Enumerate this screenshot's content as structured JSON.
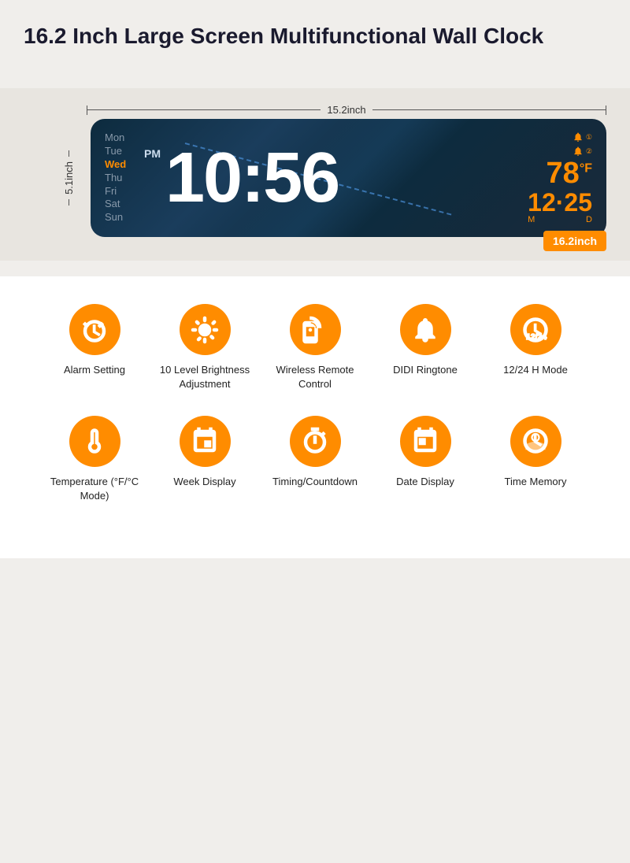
{
  "page": {
    "title": "16.2 Inch Large Screen Multifunctional Wall Clock",
    "background_color": "#f0eeeb"
  },
  "clock": {
    "width_label": "15.2inch",
    "height_label": "5.1inch",
    "size_badge": "16.2inch",
    "days": [
      "Mon",
      "Tue",
      "Wed",
      "Thu",
      "Fri",
      "Sat",
      "Sun"
    ],
    "active_day": "Wed",
    "am_pm": "PM",
    "time": "10:56",
    "temperature": "78",
    "temp_unit": "°F",
    "date": "12·25",
    "month_label": "M",
    "day_label": "D"
  },
  "features": {
    "row1": [
      {
        "id": "alarm-setting",
        "label": "Alarm Setting",
        "icon": "alarm"
      },
      {
        "id": "brightness",
        "label": "10 Level Brightness Adjustment",
        "icon": "brightness"
      },
      {
        "id": "remote",
        "label": "Wireless Remote Control",
        "icon": "remote"
      },
      {
        "id": "ringtone",
        "label": "DIDI Ringtone",
        "icon": "bell"
      },
      {
        "id": "hour-mode",
        "label": "12/24 H Mode",
        "icon": "clock-12-24"
      }
    ],
    "row2": [
      {
        "id": "temperature",
        "label": "Temperature (°F/°C Mode)",
        "icon": "thermometer"
      },
      {
        "id": "week-display",
        "label": "Week Display",
        "icon": "calendar-week"
      },
      {
        "id": "timing",
        "label": "Timing/Countdown",
        "icon": "stopwatch"
      },
      {
        "id": "date-display",
        "label": "Date Display",
        "icon": "calendar-date"
      },
      {
        "id": "time-memory",
        "label": "Time Memory",
        "icon": "brain-clock"
      }
    ]
  }
}
